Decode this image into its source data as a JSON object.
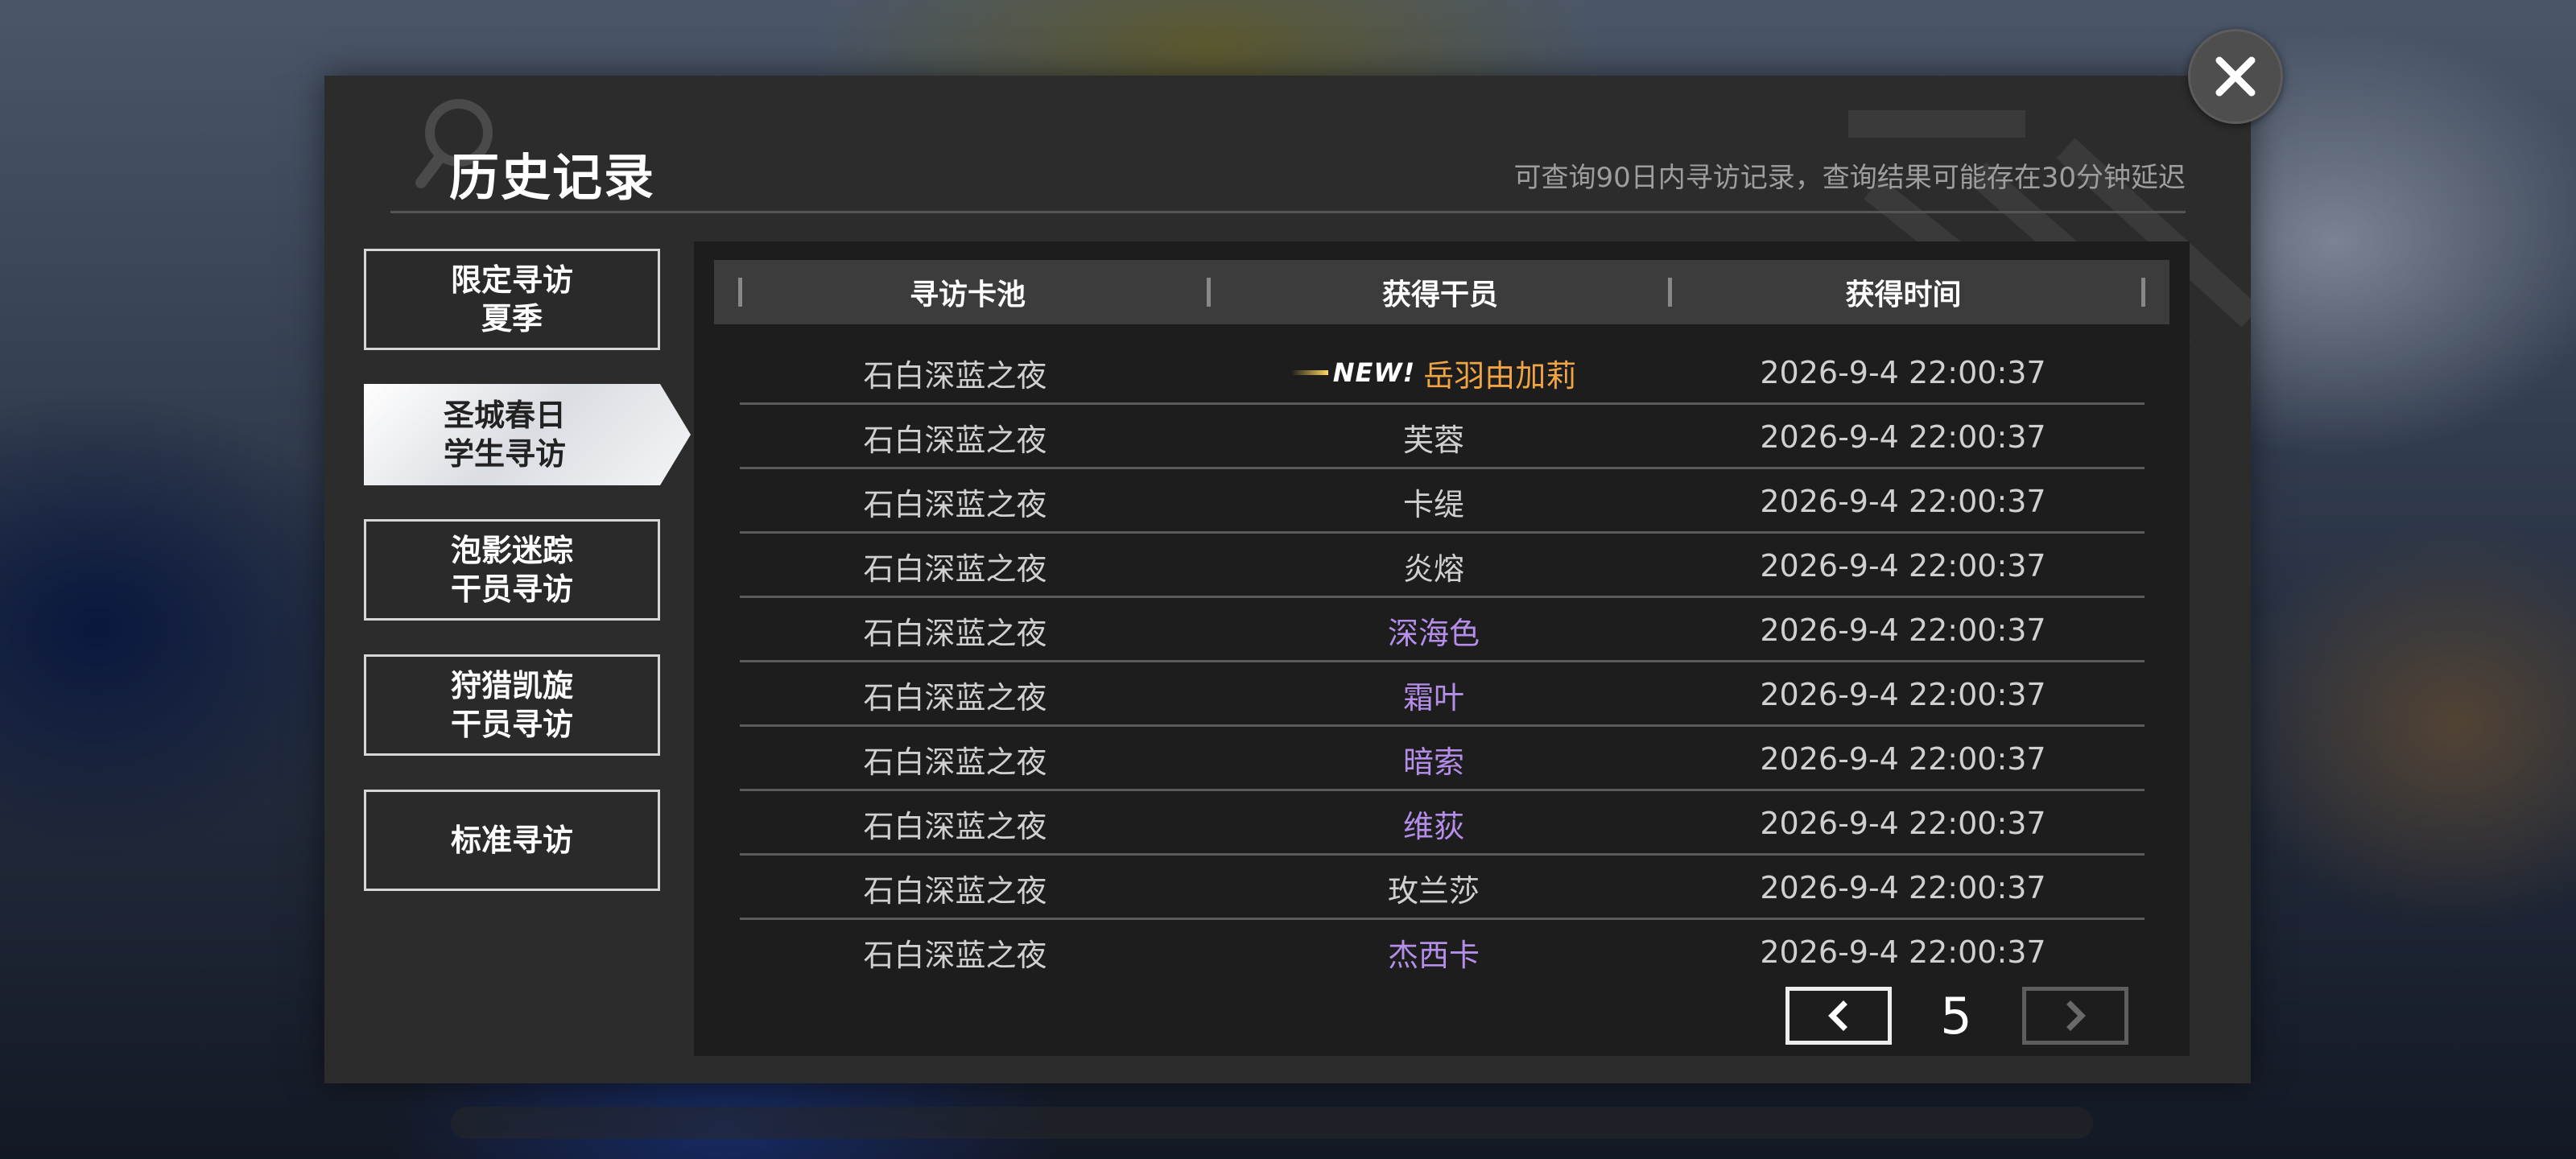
{
  "header": {
    "title": "历史记录",
    "subtitle": "可查询90日内寻访记录，查询结果可能存在30分钟延迟"
  },
  "tabs": [
    {
      "label_line1": "限定寻访",
      "label_line2": "夏季",
      "active": false
    },
    {
      "label_line1": "圣城春日",
      "label_line2": "学生寻访",
      "active": true
    },
    {
      "label_line1": "泡影迷踪",
      "label_line2": "干员寻访",
      "active": false
    },
    {
      "label_line1": "狩猎凯旋",
      "label_line2": "干员寻访",
      "active": false
    },
    {
      "label_line1": "标准寻访",
      "label_line2": "",
      "active": false
    }
  ],
  "table": {
    "columns": [
      "寻访卡池",
      "获得干员",
      "获得时间"
    ],
    "rows": [
      {
        "pool": "石白深蓝之夜",
        "operator": "岳羽由加莉",
        "time": "2026-9-4 22:00:37",
        "new": true,
        "color": "#f0a444"
      },
      {
        "pool": "石白深蓝之夜",
        "operator": "芙蓉",
        "time": "2026-9-4 22:00:37",
        "new": false,
        "color": "#d0d0d0"
      },
      {
        "pool": "石白深蓝之夜",
        "operator": "卡缇",
        "time": "2026-9-4 22:00:37",
        "new": false,
        "color": "#d0d0d0"
      },
      {
        "pool": "石白深蓝之夜",
        "operator": "炎熔",
        "time": "2026-9-4 22:00:37",
        "new": false,
        "color": "#d0d0d0"
      },
      {
        "pool": "石白深蓝之夜",
        "operator": "深海色",
        "time": "2026-9-4 22:00:37",
        "new": false,
        "color": "#b48ee8"
      },
      {
        "pool": "石白深蓝之夜",
        "operator": "霜叶",
        "time": "2026-9-4 22:00:37",
        "new": false,
        "color": "#b48ee8"
      },
      {
        "pool": "石白深蓝之夜",
        "operator": "暗索",
        "time": "2026-9-4 22:00:37",
        "new": false,
        "color": "#b48ee8"
      },
      {
        "pool": "石白深蓝之夜",
        "operator": "维荻",
        "time": "2026-9-4 22:00:37",
        "new": false,
        "color": "#b48ee8"
      },
      {
        "pool": "石白深蓝之夜",
        "operator": "玫兰莎",
        "time": "2026-9-4 22:00:37",
        "new": false,
        "color": "#d0d0d0"
      },
      {
        "pool": "石白深蓝之夜",
        "operator": "杰西卡",
        "time": "2026-9-4 22:00:37",
        "new": false,
        "color": "#b48ee8"
      }
    ],
    "new_badge_label": "NEW!"
  },
  "pagination": {
    "current_page": "5",
    "prev_enabled": true,
    "next_enabled": false
  },
  "icons": {
    "close": "close-icon",
    "search": "search-icon",
    "prev": "chevron-left-icon",
    "next": "chevron-right-icon"
  }
}
